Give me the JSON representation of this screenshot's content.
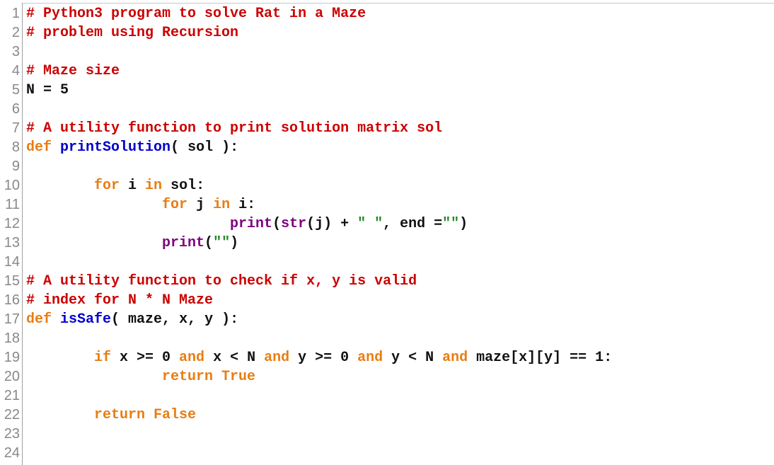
{
  "editor": {
    "language": "Python",
    "lines": [
      {
        "n": "1",
        "tokens": [
          {
            "t": "# Python3 program to solve Rat in a Maze",
            "c": "cm"
          }
        ]
      },
      {
        "n": "2",
        "tokens": [
          {
            "t": "# problem using Recursion",
            "c": "cm"
          }
        ]
      },
      {
        "n": "3",
        "tokens": []
      },
      {
        "n": "4",
        "tokens": [
          {
            "t": "# Maze size",
            "c": "cm"
          }
        ]
      },
      {
        "n": "5",
        "tokens": [
          {
            "t": "N = 5",
            "c": "tx"
          }
        ]
      },
      {
        "n": "6",
        "tokens": []
      },
      {
        "n": "7",
        "tokens": [
          {
            "t": "# A utility function to print solution matrix sol",
            "c": "cm"
          }
        ]
      },
      {
        "n": "8",
        "tokens": [
          {
            "t": "def",
            "c": "kw"
          },
          {
            "t": " ",
            "c": "tx"
          },
          {
            "t": "printSolution",
            "c": "fn"
          },
          {
            "t": "( sol ):",
            "c": "tx"
          }
        ]
      },
      {
        "n": "9",
        "tokens": []
      },
      {
        "n": "10",
        "tokens": [
          {
            "t": "        ",
            "c": "tx"
          },
          {
            "t": "for",
            "c": "kw"
          },
          {
            "t": " i ",
            "c": "tx"
          },
          {
            "t": "in",
            "c": "kw"
          },
          {
            "t": " sol:",
            "c": "tx"
          }
        ]
      },
      {
        "n": "11",
        "tokens": [
          {
            "t": "                ",
            "c": "tx"
          },
          {
            "t": "for",
            "c": "kw"
          },
          {
            "t": " j ",
            "c": "tx"
          },
          {
            "t": "in",
            "c": "kw"
          },
          {
            "t": " i:",
            "c": "tx"
          }
        ]
      },
      {
        "n": "12",
        "tokens": [
          {
            "t": "                        ",
            "c": "tx"
          },
          {
            "t": "print",
            "c": "bi"
          },
          {
            "t": "(",
            "c": "tx"
          },
          {
            "t": "str",
            "c": "bi"
          },
          {
            "t": "(j) + ",
            "c": "tx"
          },
          {
            "t": "\" \"",
            "c": "st"
          },
          {
            "t": ", end =",
            "c": "tx"
          },
          {
            "t": "\"\"",
            "c": "st"
          },
          {
            "t": ")",
            "c": "tx"
          }
        ]
      },
      {
        "n": "13",
        "tokens": [
          {
            "t": "                ",
            "c": "tx"
          },
          {
            "t": "print",
            "c": "bi"
          },
          {
            "t": "(",
            "c": "tx"
          },
          {
            "t": "\"\"",
            "c": "st"
          },
          {
            "t": ")",
            "c": "tx"
          }
        ]
      },
      {
        "n": "14",
        "tokens": []
      },
      {
        "n": "15",
        "tokens": [
          {
            "t": "# A utility function to check if x, y is valid",
            "c": "cm"
          }
        ]
      },
      {
        "n": "16",
        "tokens": [
          {
            "t": "# index for N * N Maze",
            "c": "cm"
          }
        ]
      },
      {
        "n": "17",
        "tokens": [
          {
            "t": "def",
            "c": "kw"
          },
          {
            "t": " ",
            "c": "tx"
          },
          {
            "t": "isSafe",
            "c": "fn"
          },
          {
            "t": "( maze, x, y ):",
            "c": "tx"
          }
        ]
      },
      {
        "n": "18",
        "tokens": []
      },
      {
        "n": "19",
        "tokens": [
          {
            "t": "        ",
            "c": "tx"
          },
          {
            "t": "if",
            "c": "kw"
          },
          {
            "t": " x >= 0 ",
            "c": "tx"
          },
          {
            "t": "and",
            "c": "kw"
          },
          {
            "t": " x < N ",
            "c": "tx"
          },
          {
            "t": "and",
            "c": "kw"
          },
          {
            "t": " y >= 0 ",
            "c": "tx"
          },
          {
            "t": "and",
            "c": "kw"
          },
          {
            "t": " y < N ",
            "c": "tx"
          },
          {
            "t": "and",
            "c": "kw"
          },
          {
            "t": " maze[x][y] == 1:",
            "c": "tx"
          }
        ]
      },
      {
        "n": "20",
        "tokens": [
          {
            "t": "                ",
            "c": "tx"
          },
          {
            "t": "return True",
            "c": "kw"
          }
        ]
      },
      {
        "n": "21",
        "tokens": []
      },
      {
        "n": "22",
        "tokens": [
          {
            "t": "        ",
            "c": "tx"
          },
          {
            "t": "return False",
            "c": "kw"
          }
        ]
      },
      {
        "n": "23",
        "tokens": []
      },
      {
        "n": "24",
        "tokens": []
      }
    ]
  }
}
